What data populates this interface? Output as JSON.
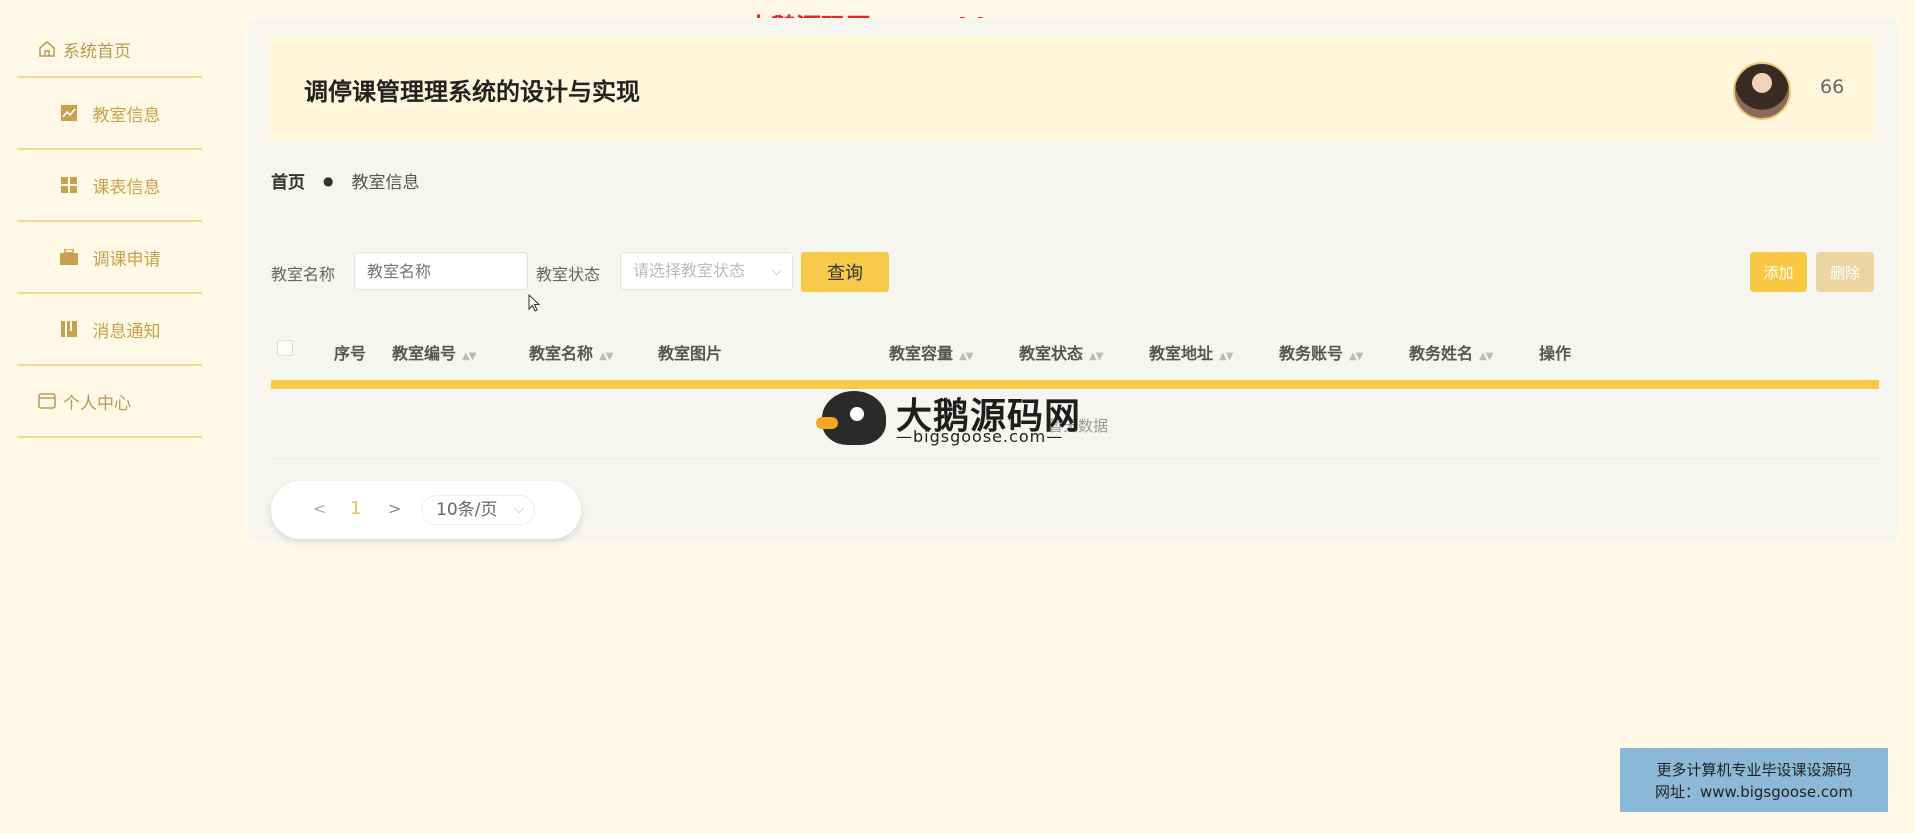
{
  "watermark_top": "大鹅源码网:www.bigsgoose.com",
  "sidebar": {
    "items": [
      {
        "label": "系统首页",
        "icon": "home-icon"
      },
      {
        "label": "教室信息",
        "icon": "chart-icon"
      },
      {
        "label": "课表信息",
        "icon": "grid-icon"
      },
      {
        "label": "调课申请",
        "icon": "briefcase-icon"
      },
      {
        "label": "消息通知",
        "icon": "book-icon"
      },
      {
        "label": "个人中心",
        "icon": "wallet-icon"
      }
    ]
  },
  "header": {
    "title": "调停课管理理系统的设计与实现",
    "username": "66"
  },
  "breadcrumb": {
    "home": "首页",
    "separator": "●",
    "current": "教室信息"
  },
  "search": {
    "name_label": "教室名称",
    "name_placeholder": "教室名称",
    "status_label": "教室状态",
    "status_placeholder": "请选择教室状态",
    "query_button": "查询",
    "add_button": "添加",
    "delete_button": "删除"
  },
  "table": {
    "columns": [
      "序号",
      "教室编号",
      "教室名称",
      "教室图片",
      "教室容量",
      "教室状态",
      "教室地址",
      "教务账号",
      "教务姓名",
      "操作"
    ],
    "empty_text": "暂无数据"
  },
  "pagination": {
    "prev": "<",
    "current_page": "1",
    "next": ">",
    "page_size": "10条/页"
  },
  "logo_watermark": {
    "name": "大鹅源码网",
    "url": "—bigsgoose.com—"
  },
  "promo": {
    "line1": "更多计算机专业毕设课设源码",
    "line2": "网址：www.bigsgoose.com"
  }
}
